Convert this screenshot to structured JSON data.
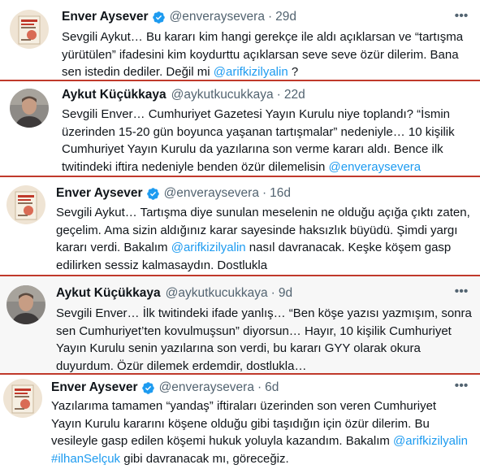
{
  "tweets": [
    {
      "name": "Enver Aysever",
      "handle": "@enveraysevera",
      "time": "29d",
      "verified": true,
      "avatar": "book-cover-avatar",
      "lines": [
        [
          {
            "t": "Sevgili Aykut… Bu kararı kim hangi gerekçe ile aldı açıklarsan ve “tartışma"
          }
        ],
        [
          {
            "t": "yürütülen” ifadesini kim koydurttu açıklarsan seve seve özür dilerim. Bana"
          }
        ],
        [
          {
            "t": "sen istedin dediler. Değil mi "
          },
          {
            "t": "@arifkizilyalin",
            "m": true
          },
          {
            "t": " ?"
          }
        ]
      ]
    },
    {
      "name": "Aykut Küçükkaya",
      "handle": "@aykutkucukkaya",
      "time": "22d",
      "verified": false,
      "avatar": "person-photo-avatar",
      "lines": [
        [
          {
            "t": "Sevgili Enver… Cumhuriyet Gazetesi Yayın Kurulu niye toplandı? “İsmin"
          }
        ],
        [
          {
            "t": "üzerinden 15-20 gün boyunca yaşanan tartışmalar” nedeniyle… 10 kişilik"
          }
        ],
        [
          {
            "t": "Cumhuriyet Yayın Kurulu da yazılarına son verme kararı aldı. Bence ilk"
          }
        ],
        [
          {
            "t": "twitindeki iftira nedeniyle benden özür dilemelisin "
          },
          {
            "t": "@enveraysevera",
            "m": true
          }
        ]
      ]
    },
    {
      "name": "Enver Aysever",
      "handle": "@enveraysevera",
      "time": "16d",
      "verified": true,
      "avatar": "book-cover-avatar",
      "lines": [
        [
          {
            "t": "Sevgili Aykut… Tartışma diye sunulan meselenin ne olduğu açığa çıktı zaten,"
          }
        ],
        [
          {
            "t": "geçelim. Ama sizin aldığınız karar sayesinde haksızlık büyüdü. Şimdi yargı"
          }
        ],
        [
          {
            "t": "kararı verdi. Bakalım "
          },
          {
            "t": "@arifkizilyalin",
            "m": true
          },
          {
            "t": " nasıl davranacak. Keşke köşem gasp"
          }
        ],
        [
          {
            "t": "edilirken sessiz kalmasaydın. Dostlukla"
          }
        ]
      ]
    },
    {
      "name": "Aykut Küçükkaya",
      "handle": "@aykutkucukkaya",
      "time": "9d",
      "verified": false,
      "avatar": "person-photo-avatar",
      "lines": [
        [
          {
            "t": "Sevgili Enver… İlk twitindeki ifade yanlış… “Ben köşe yazısı yazmışım, sonra"
          }
        ],
        [
          {
            "t": "sen Cumhuriyet’ten kovulmuşsun” diyorsun… Hayır, 10 kişilik Cumhuriyet"
          }
        ],
        [
          {
            "t": "Yayın Kurulu senin yazılarına son verdi, bu kararı GYY olarak okura"
          }
        ],
        [
          {
            "t": "duyurdum. Özür dilemek erdemdir, dostlukla…"
          }
        ]
      ]
    },
    {
      "name": "Enver Aysever",
      "handle": "@enveraysevera",
      "time": "6d",
      "verified": true,
      "avatar": "book-cover-avatar",
      "lines": [
        [
          {
            "t": "Yazılarıma tamamen “yandaş” iftiraları üzerinden son veren Cumhuriyet"
          }
        ],
        [
          {
            "t": "Yayın Kurulu kararını köşene olduğu gibi taşıdığın için özür dilerim. Bu"
          }
        ],
        [
          {
            "t": "vesileyle gasp edilen köşemi hukuk yoluyla kazandım. Bakalım "
          },
          {
            "t": "@arifkizilyalin",
            "m": true
          }
        ],
        [
          {
            "t": "#ilhanSelçuk",
            "m": true
          },
          {
            "t": " gibi davranacak mı, göreceğiz."
          }
        ]
      ]
    }
  ],
  "separator_dot": "·",
  "more_label": "•••",
  "colors": {
    "mention": "#1d9bf0",
    "verified": "#1d9bf0",
    "separator": "#c0392b",
    "muted": "#536471"
  }
}
